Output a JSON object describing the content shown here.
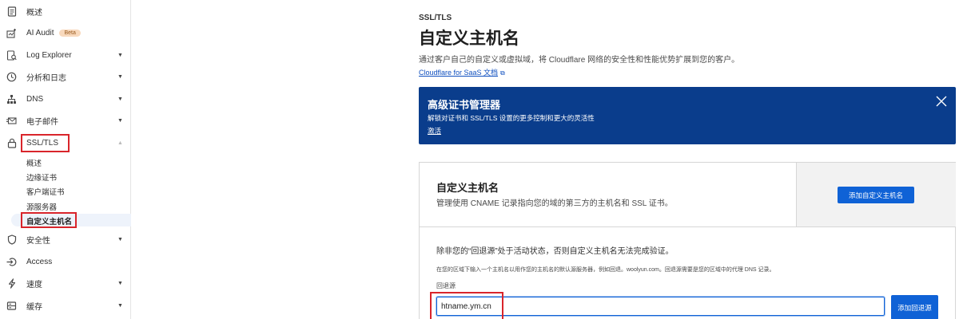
{
  "sidebar": {
    "items": [
      {
        "label": "概述",
        "icon": "document-icon",
        "expandable": false
      },
      {
        "label": "AI Audit",
        "icon": "ai-audit-icon",
        "expandable": false,
        "badge": "Beta"
      },
      {
        "label": "Log Explorer",
        "icon": "log-explorer-icon",
        "expandable": true
      },
      {
        "label": "分析和日志",
        "icon": "clock-icon",
        "expandable": true
      },
      {
        "label": "DNS",
        "icon": "network-icon",
        "expandable": true
      },
      {
        "label": "电子邮件",
        "icon": "email-icon",
        "expandable": true
      },
      {
        "label": "SSL/TLS",
        "icon": "lock-icon",
        "expandable": true,
        "expanded": true
      },
      {
        "label": "安全性",
        "icon": "shield-icon",
        "expandable": true
      },
      {
        "label": "Access",
        "icon": "access-icon",
        "expandable": false
      },
      {
        "label": "速度",
        "icon": "bolt-icon",
        "expandable": true
      },
      {
        "label": "缓存",
        "icon": "cache-icon",
        "expandable": true
      }
    ],
    "ssl_sub": [
      "概述",
      "边缘证书",
      "客户端证书",
      "源服务器",
      "自定义主机名"
    ],
    "active_sub": "自定义主机名"
  },
  "main": {
    "breadcrumb": "SSL/TLS",
    "title": "自定义主机名",
    "description": "通过客户自己的自定义或虚拟域，将 Cloudflare 网络的安全性和性能优势扩展到您的客户。",
    "doc_link": "Cloudflare for SaaS 文档"
  },
  "banner": {
    "title": "高级证书管理器",
    "body": "解锁对证书和 SSL/TLS 设置的更多控制和更大的灵活性",
    "link": "激活",
    "bg_color": "#0a3d8c"
  },
  "card": {
    "title": "自定义主机名",
    "description": "管理使用 CNAME 记录指向您的域的第三方的主机名和 SSL 证书。",
    "add_button": "添加自定义主机名",
    "warning": "除非您的“回退源”处于活动状态，否则自定义主机名无法完成验证。",
    "hint": "在您的区域下输入一个主机名以用作您的主机名的默认源服务器，例如回退。woolyun.com。回退源需要是您的区域中的代理 DNS 记录。",
    "fallback_label": "回退源",
    "fallback_value": "htname.ym.cn",
    "fallback_button": "添加回退源"
  },
  "colors": {
    "accent": "#0f62d6",
    "highlight": "#d9252b"
  }
}
